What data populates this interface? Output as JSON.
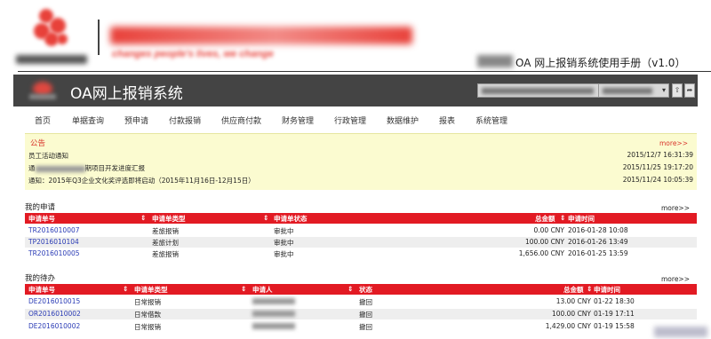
{
  "doc_header": {
    "slogan_en": "changes people's lives, we change",
    "doc_title": "OA 网上报销系统使用手册（v1.0）"
  },
  "app": {
    "title": "OA网上报销系统",
    "icons": {
      "dropdown": "chevron-down-icon",
      "up": "arrow-up-icon",
      "logout": "exit-icon"
    }
  },
  "nav": {
    "items": [
      "首页",
      "单据查询",
      "预申请",
      "付款报销",
      "供应商付款",
      "财务管理",
      "行政管理",
      "数据维护",
      "报表",
      "系统管理"
    ]
  },
  "notice": {
    "title": "公告",
    "more": "more>>",
    "items": [
      {
        "text": "员工活动通知",
        "time": "2015/12/7 16:31:39"
      },
      {
        "text_prefix": "通",
        "text_suffix": "期项目开发进度汇报",
        "time": "2015/11/25 19:17:20"
      },
      {
        "text": "通知：2015年Q3企业文化奖评选即将启动（2015年11月16日-12月15日）",
        "time": "2015/11/24 10:05:39"
      }
    ]
  },
  "my_applications": {
    "title": "我的申请",
    "more": "more>>",
    "headers": [
      "申请单号",
      "申请单类型",
      "申请单状态",
      "总金额",
      "申请时间"
    ],
    "rows": [
      {
        "id": "TR2016010007",
        "type": "差旅报销",
        "status": "审批中",
        "amount": "0.00 CNY",
        "time": "2016-01-28 10:08"
      },
      {
        "id": "TP2016010104",
        "type": "差旅计划",
        "status": "审批中",
        "amount": "100.00 CNY",
        "time": "2016-01-26 13:49"
      },
      {
        "id": "TR2016010005",
        "type": "差旅报销",
        "status": "审批中",
        "amount": "1,656.00 CNY",
        "time": "2016-01-25 13:59"
      }
    ]
  },
  "my_todo": {
    "title": "我的待办",
    "more": "more>>",
    "headers": [
      "申请单号",
      "申请单类型",
      "申请人",
      "状态",
      "总金额",
      "申请时间"
    ],
    "rows": [
      {
        "id": "DE2016010015",
        "type": "日常报销",
        "status": "撤回",
        "amount": "13.00 CNY",
        "time": "01-22 18:30"
      },
      {
        "id": "OR2016010002",
        "type": "日常借款",
        "status": "撤回",
        "amount": "100.00 CNY",
        "time": "01-19 17:11"
      },
      {
        "id": "DE2016010002",
        "type": "日常报销",
        "status": "撤回",
        "amount": "1,429.00 CNY",
        "time": "01-19 15:58"
      }
    ]
  },
  "colors": {
    "accent": "#e21a23",
    "app_bar": "#444444",
    "notice_bg": "#fbfbd0",
    "link": "#2a3bb5"
  }
}
